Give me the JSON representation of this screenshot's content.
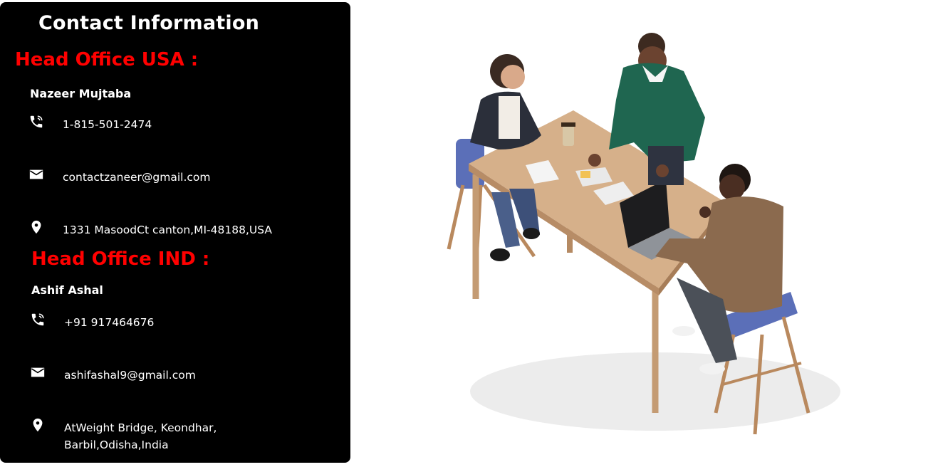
{
  "title": "Contact Information",
  "offices": [
    {
      "heading": "Head Office USA :",
      "person": "Nazeer Mujtaba",
      "phone": "1-815-501-2474",
      "email": "contactzaneer@gmail.com",
      "address": "1331 MasoodCt canton,MI-48188,USA"
    },
    {
      "heading": "Head Office IND :",
      "person": "Ashif Ashal",
      "phone": "+91 917464676",
      "email": "ashifashal9@gmail.com",
      "address": "AtWeight Bridge, Keondhar, Barbil,Odisha,India"
    }
  ],
  "colors": {
    "accent": "#ff0000",
    "card": "#000000"
  },
  "icons": {
    "phone": "phone-icon",
    "email": "mail-icon",
    "address": "location-pin-icon"
  }
}
